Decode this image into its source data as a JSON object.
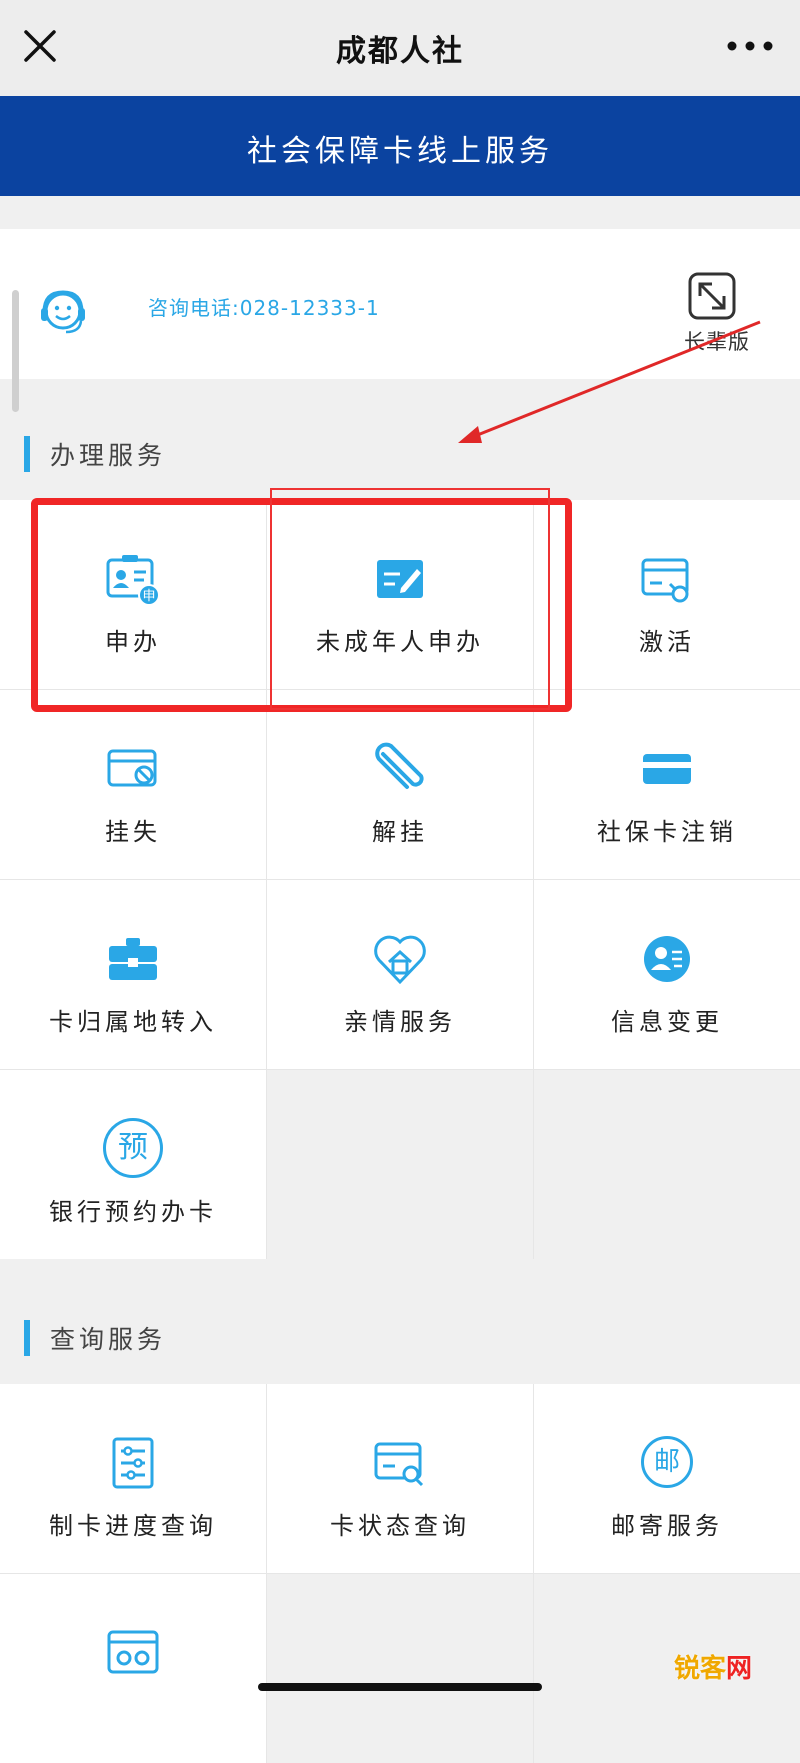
{
  "titlebar": {
    "title": "成都人社",
    "close_icon": "close-icon",
    "more_icon": "more-icon"
  },
  "banner": {
    "title": "社会保障卡线上服务"
  },
  "info": {
    "phone": "咨询电话:028-12333-1",
    "elder_label": "长辈版",
    "support_icon": "support-agent-icon",
    "elder_icon": "expand-icon"
  },
  "sections": {
    "handle": {
      "label": "办理服务",
      "items": [
        {
          "label": "申办",
          "icon": "id-card-apply-icon"
        },
        {
          "label": "未成年人申办",
          "icon": "minor-apply-icon"
        },
        {
          "label": "激活",
          "icon": "card-activate-icon"
        },
        {
          "label": "挂失",
          "icon": "card-lost-icon"
        },
        {
          "label": "解挂",
          "icon": "paperclip-icon"
        },
        {
          "label": "社保卡注销",
          "icon": "card-cancel-icon"
        },
        {
          "label": "卡归属地转入",
          "icon": "briefcase-icon"
        },
        {
          "label": "亲情服务",
          "icon": "home-heart-icon"
        },
        {
          "label": "信息变更",
          "icon": "user-info-icon"
        },
        {
          "label": "银行预约办卡",
          "icon": "reserve-icon"
        }
      ]
    },
    "query": {
      "label": "查询服务",
      "items": [
        {
          "label": "制卡进度查询",
          "icon": "progress-icon"
        },
        {
          "label": "卡状态查询",
          "icon": "card-search-icon"
        },
        {
          "label": "邮寄服务",
          "icon": "mail-icon"
        }
      ]
    }
  },
  "icons": {
    "reserve_char": "预",
    "mail_char": "邮"
  },
  "watermark": {
    "text_a": "锐客",
    "text_b": "网"
  },
  "colors": {
    "accent": "#2aa7e6",
    "banner": "#0b43a0",
    "highlight": "#f02626"
  }
}
